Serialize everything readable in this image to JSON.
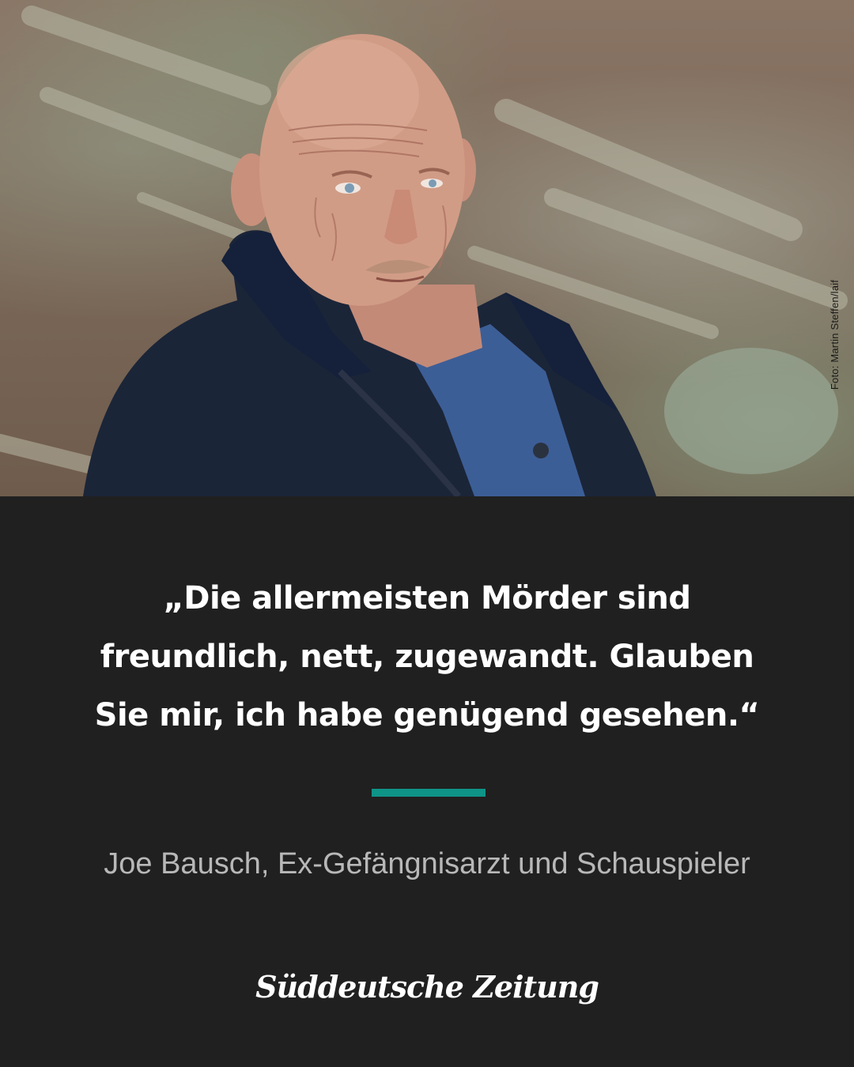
{
  "photo": {
    "credit": "Foto: Martin Steffen/laif",
    "subject": "portrait-photo"
  },
  "quote": {
    "lines": [
      "„Die allermeisten Mörder sind",
      "freundlich, nett, zugewandt. Glauben",
      "Sie mir, ich habe genügend gesehen.“"
    ]
  },
  "attribution": "Joe Bausch, Ex-Gefängnisarzt und Schauspieler",
  "brand": {
    "logo": "Süddeutsche Zeitung"
  },
  "colors": {
    "background": "#202020",
    "accent": "#0f9488",
    "quote_text": "#ffffff",
    "attribution_text": "#b8b8b8"
  }
}
